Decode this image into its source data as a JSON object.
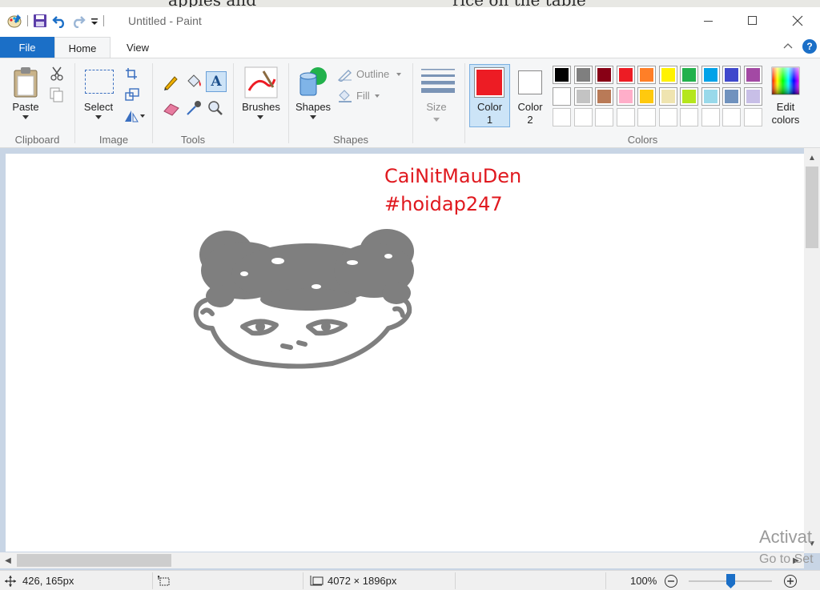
{
  "background_doc": {
    "left_text": "apples and",
    "right_text": "rice on the table"
  },
  "window": {
    "title": "Untitled - Paint"
  },
  "tabs": {
    "file": "File",
    "home": "Home",
    "view": "View"
  },
  "ribbon": {
    "clipboard": {
      "group_label": "Clipboard",
      "paste_label": "Paste"
    },
    "image": {
      "group_label": "Image",
      "select_label": "Select"
    },
    "tools": {
      "group_label": "Tools"
    },
    "brushes": {
      "label": "Brushes"
    },
    "shapes": {
      "group_label": "Shapes",
      "shapes_label": "Shapes",
      "outline_label": "Outline",
      "fill_label": "Fill"
    },
    "size": {
      "label": "Size"
    },
    "colors": {
      "group_label": "Colors",
      "color1_label": "Color",
      "color1_num": "1",
      "color2_label": "Color",
      "color2_num": "2",
      "edit_line1": "Edit",
      "edit_line2": "colors",
      "color1_value": "#ed1c24",
      "color2_value": "#ffffff",
      "palette_row1": [
        "#000000",
        "#7f7f7f",
        "#880015",
        "#ed1c24",
        "#ff7f27",
        "#fff200",
        "#22b14c",
        "#00a2e8",
        "#3f48cc",
        "#a349a4"
      ],
      "palette_row2": [
        "#ffffff",
        "#c3c3c3",
        "#b97a57",
        "#ffaec9",
        "#ffc90e",
        "#efe4b0",
        "#b5e61d",
        "#99d9ea",
        "#7092be",
        "#c8bfe7"
      ]
    }
  },
  "canvas": {
    "text_line1": "CaiNitMauDen",
    "text_line2": "#hoidap247"
  },
  "status": {
    "cursor_pos": "426, 165px",
    "canvas_size": "4072 × 1896px",
    "zoom": "100%"
  },
  "watermark": {
    "line1": "Activat",
    "line2": "Go to Set"
  }
}
